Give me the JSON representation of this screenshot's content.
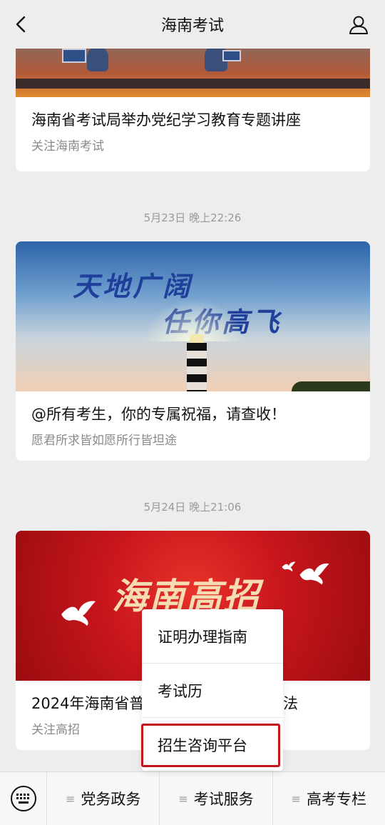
{
  "header": {
    "title": "海南考试",
    "back_icon": "back-chevron-icon",
    "profile_icon": "user-profile-icon"
  },
  "feed": {
    "cards": [
      {
        "title": "海南省考试局举办党纪学习教育专题讲座",
        "subtitle": "关注海南考试"
      },
      {
        "timestamp": "5月23日 晚上22:26",
        "image_text_line1": "天地广阔",
        "image_text_line2": "任你高飞",
        "title": "@所有考生，你的专属祝福，请查收！",
        "subtitle": "愿君所求皆如愿所行皆坦途"
      },
      {
        "timestamp": "5月24日 晚上21:06",
        "image_text": "海南高招",
        "title": "2024年海南省普",
        "title_suffix": "法",
        "subtitle": "关注高招"
      }
    ]
  },
  "popup_menu": {
    "items": [
      "证明办理指南",
      "考试历",
      "招生咨询平台"
    ],
    "highlighted_index": 2,
    "highlight_color": "#c1151b"
  },
  "bottom_bar": {
    "keyboard_icon": "keyboard-icon",
    "menus": [
      "党务政务",
      "考试服务",
      "高考专栏"
    ],
    "menu_icon": "hamburger-icon"
  }
}
